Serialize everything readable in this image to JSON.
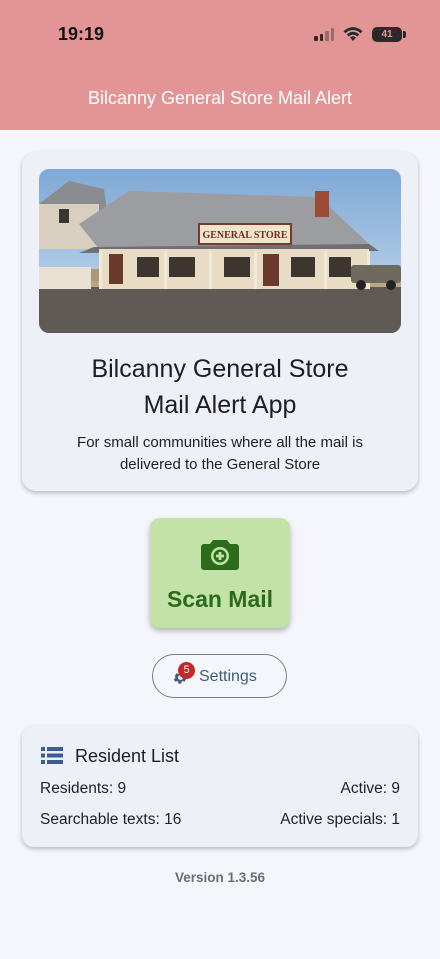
{
  "status_bar": {
    "time": "19:19",
    "battery": "41"
  },
  "header": {
    "title": "Bilcanny General Store Mail Alert"
  },
  "intro": {
    "sign_text": "GENERAL STORE",
    "title_line1": "Bilcanny General Store",
    "title_line2": "Mail Alert App",
    "description_line1": "For small communities where all the mail is",
    "description_line2": "delivered to the General Store"
  },
  "scan": {
    "label": "Scan Mail",
    "icon": "camera-add-icon"
  },
  "settings": {
    "label": "Settings",
    "badge_count": "5",
    "icon": "gear-icon"
  },
  "resident_list": {
    "title": "Resident List",
    "icon": "list-icon",
    "residents": "Residents: 9",
    "active": "Active: 9",
    "searchable_texts": "Searchable texts: 16",
    "active_specials": "Active specials: 1"
  },
  "footer": {
    "version": "Version 1.3.56"
  },
  "colors": {
    "header": "#e39596",
    "scan_bg": "#c3e2a8",
    "scan_text": "#2c6a1c",
    "badge": "#c3292a"
  }
}
